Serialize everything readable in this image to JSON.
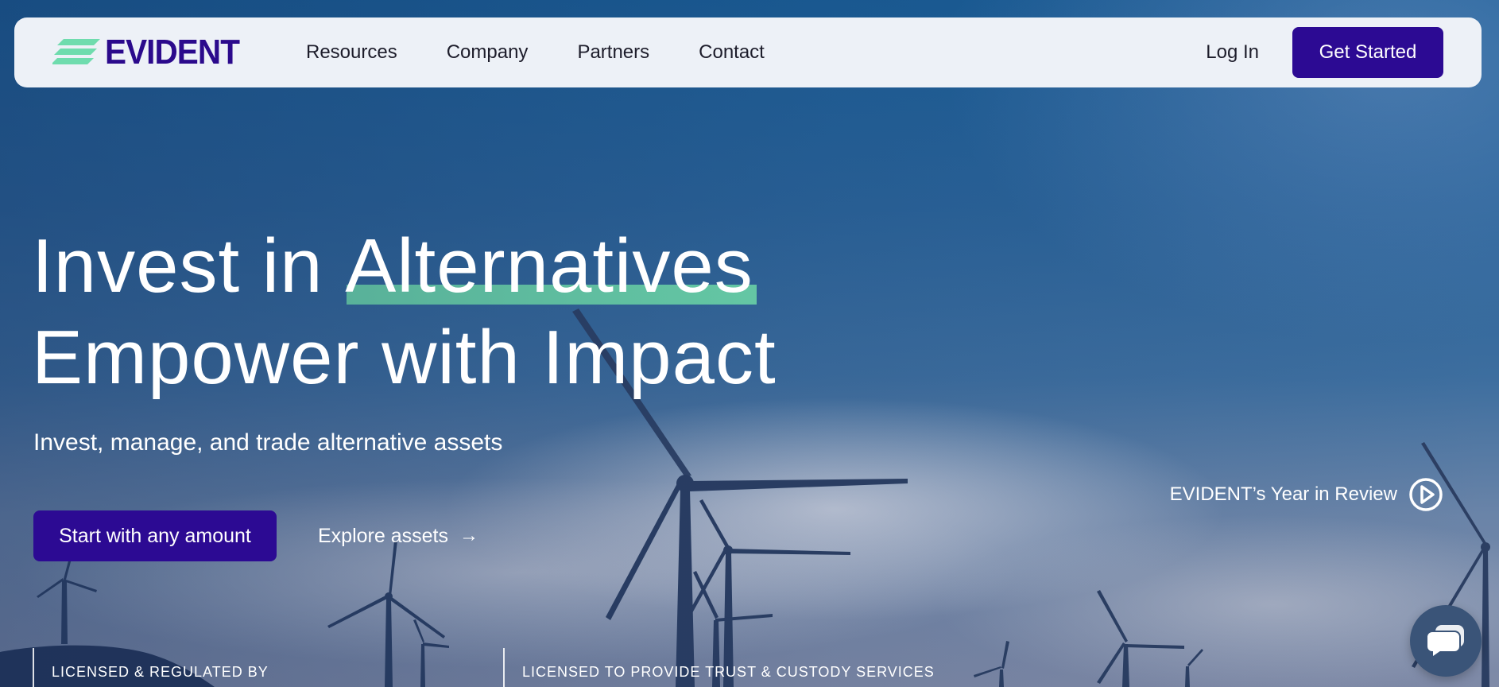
{
  "brand": {
    "name": "EVIDENT",
    "colors": {
      "primary": "#2c0a93",
      "accent": "#6fdcae",
      "nav_background": "#edf1f7"
    }
  },
  "nav": {
    "links": [
      {
        "label": "Resources"
      },
      {
        "label": "Company"
      },
      {
        "label": "Partners"
      },
      {
        "label": "Contact"
      }
    ],
    "login_label": "Log In",
    "get_started_label": "Get Started"
  },
  "hero": {
    "line1_prefix": "Invest in ",
    "line1_highlight": "Alternatives",
    "line2": "Empower with Impact",
    "subtitle": "Invest, manage, and trade alternative assets",
    "primary_cta": "Start with any amount",
    "secondary_cta": "Explore assets",
    "secondary_cta_icon": "arrow-right-icon",
    "year_review_label": "EVIDENT’s Year in Review",
    "year_review_icon": "play-circle-icon"
  },
  "licences": [
    {
      "label": "LICENSED & REGULATED BY"
    },
    {
      "label": "LICENSED TO PROVIDE TRUST & CUSTODY SERVICES"
    }
  ],
  "chat": {
    "icon": "chat-bubble-icon"
  }
}
